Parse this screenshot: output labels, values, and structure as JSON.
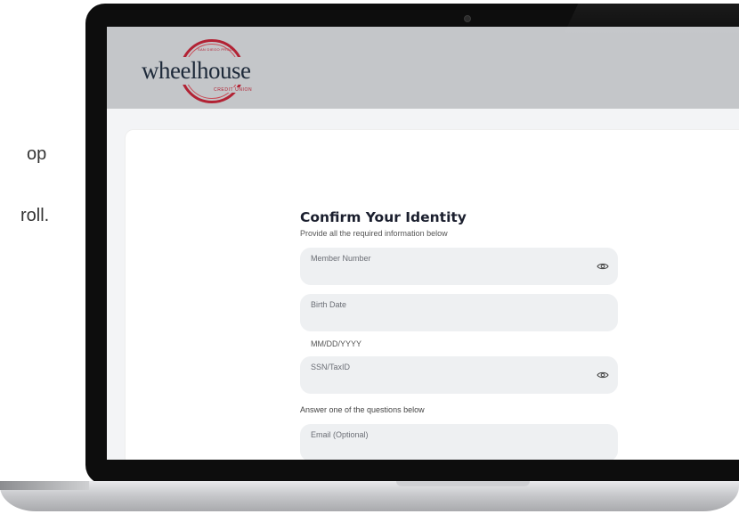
{
  "side_text": {
    "line1": "op",
    "line2": "roll."
  },
  "app": {
    "logo": {
      "wordmark": "wheelhouse",
      "tagline": "CREDIT UNION",
      "arc_text": "SAN DIEGO PROUD"
    }
  },
  "form": {
    "title": "Confirm Your Identity",
    "subtitle": "Provide all the required information below",
    "fields": {
      "member_number": {
        "label": "Member Number",
        "value": ""
      },
      "birth_date": {
        "label": "Birth Date",
        "value": "",
        "helper": "MM/DD/YYYY"
      },
      "ssn": {
        "label": "SSN/TaxID",
        "value": ""
      },
      "email": {
        "label": "Email (Optional)",
        "value": ""
      }
    },
    "questions_note": "Answer one of the questions below"
  },
  "colors": {
    "header_bg": "#c4c6c9",
    "brand_red": "#b22234",
    "field_bg": "#eef0f2"
  }
}
